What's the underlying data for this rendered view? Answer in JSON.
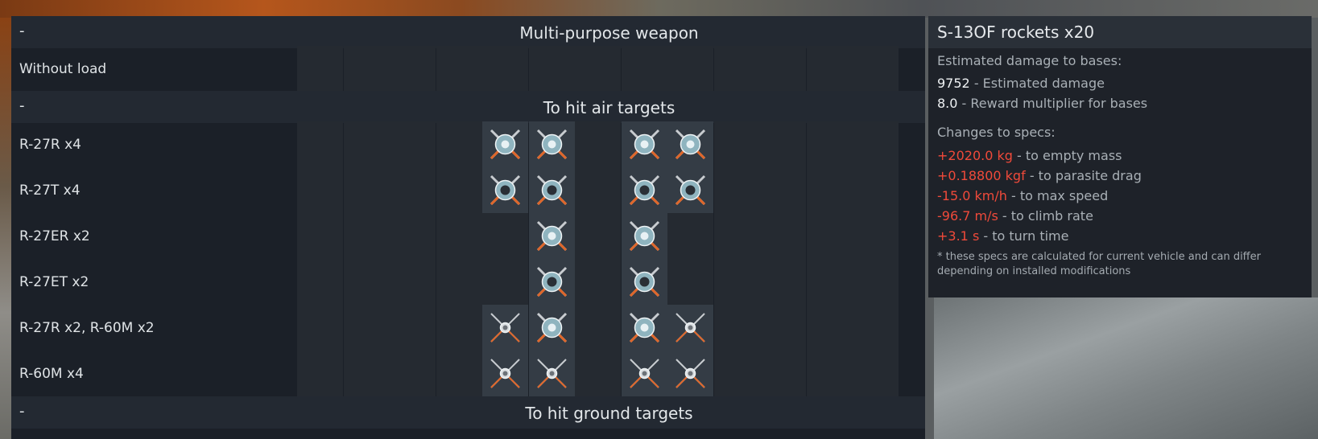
{
  "sections": {
    "multipurpose": {
      "dash": "-",
      "title": "Multi-purpose weapon"
    },
    "air": {
      "dash": "-",
      "title": "To hit air targets"
    },
    "ground": {
      "dash": "-",
      "title": "To hit ground targets"
    }
  },
  "presets": [
    {
      "label": "Without load",
      "slots": [
        "",
        "",
        "",
        "",
        "",
        "",
        "",
        "",
        "",
        "",
        "",
        "",
        ""
      ]
    },
    {
      "label": "R-27R x4",
      "slots": [
        "",
        "",
        "",
        "",
        "r27r",
        "r27r",
        "",
        "r27r",
        "r27r",
        "",
        "",
        "",
        ""
      ]
    },
    {
      "label": "R-27T x4",
      "slots": [
        "",
        "",
        "",
        "",
        "r27t",
        "r27t",
        "",
        "r27t",
        "r27t",
        "",
        "",
        "",
        ""
      ]
    },
    {
      "label": "R-27ER x2",
      "slots": [
        "",
        "",
        "",
        "",
        "",
        "r27er",
        "",
        "r27er",
        "",
        "",
        "",
        "",
        ""
      ]
    },
    {
      "label": "R-27ET x2",
      "slots": [
        "",
        "",
        "",
        "",
        "",
        "r27et",
        "",
        "r27et",
        "",
        "",
        "",
        "",
        ""
      ]
    },
    {
      "label": "R-27R x2,  R-60M x2",
      "slots": [
        "",
        "",
        "",
        "",
        "r60m",
        "r27r",
        "",
        "r27r",
        "r60m",
        "",
        "",
        "",
        ""
      ]
    },
    {
      "label": "R-60M x4",
      "slots": [
        "",
        "",
        "",
        "",
        "r60m",
        "r60m",
        "",
        "r60m",
        "r60m",
        "",
        "",
        "",
        ""
      ]
    }
  ],
  "info": {
    "title": "S-13OF rockets x20",
    "damage_header": "Estimated damage to bases:",
    "damage_value": "9752",
    "damage_label": "- Estimated damage",
    "reward_value": "8.0",
    "reward_label": "- Reward multiplier for bases",
    "changes_header": "Changes to specs:",
    "changes": [
      {
        "value": "+2020.0 kg",
        "label": "- to empty mass"
      },
      {
        "value": "+0.18800 kgf",
        "label": "- to parasite drag"
      },
      {
        "value": "-15.0 km/h",
        "label": "- to max speed"
      },
      {
        "value": "-96.7 m/s",
        "label": "- to climb rate"
      },
      {
        "value": "+3.1 s",
        "label": "- to turn time"
      }
    ],
    "note": "* these specs are calculated for current vehicle and can differ depending on installed modifications"
  },
  "colors": {
    "negative": "#f04a3a",
    "panel": "#1b2028",
    "slot_filled": "#343c45"
  }
}
